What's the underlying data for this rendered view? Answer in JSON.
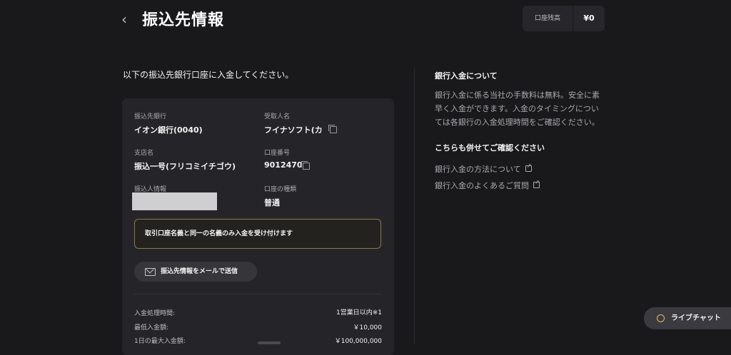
{
  "header": {
    "back_icon": "chevron-left-icon",
    "back_glyph": "‹",
    "title": "振込先情報",
    "balance_label": "口座残高",
    "balance_value": "¥0"
  },
  "instruction": "以下の振込先銀行口座に入金してください。",
  "card": {
    "bank_label": "振込先銀行",
    "bank_value": "イオン銀行(0040)",
    "recipient_label": "受取人名",
    "recipient_value": "フイナソフト(カ",
    "branch_label": "支店名",
    "branch_value": "振込一号(フリコミイチゴウ)",
    "account_no_label": "口座番号",
    "account_no_value": "9012470",
    "depositor_label": "振込人情報",
    "account_type_label": "口座の種類",
    "account_type_value": "普通",
    "notice": "取引口座名義と同一の名義のみ入金を受け付けます",
    "email_button": "振込先情報をメールで送信",
    "rows": [
      {
        "label": "入金処理時間:",
        "value": "1営業日以内※1"
      },
      {
        "label": "最低入金額:",
        "value": "￥10,000"
      },
      {
        "label": "1日の最大入金額:",
        "value": "￥100,000,000"
      }
    ]
  },
  "info": {
    "title": "銀行入金について",
    "body": "銀行入金に係る当社の手数料は無料。安全に素早く入金ができます。入金のタイミングについては各銀行の入金処理時間をご確認ください。",
    "also_title": "こちらも併せてご確認ください",
    "links": [
      "銀行入金の方法について",
      "銀行入金のよくあるご質問"
    ]
  },
  "chat": {
    "label": "ライブチャット",
    "icon": "chat-bubble-icon"
  },
  "colors": {
    "background": "#19191c",
    "card": "#252529",
    "notice_border": "#8a7a45",
    "accent": "#e7b85a"
  }
}
